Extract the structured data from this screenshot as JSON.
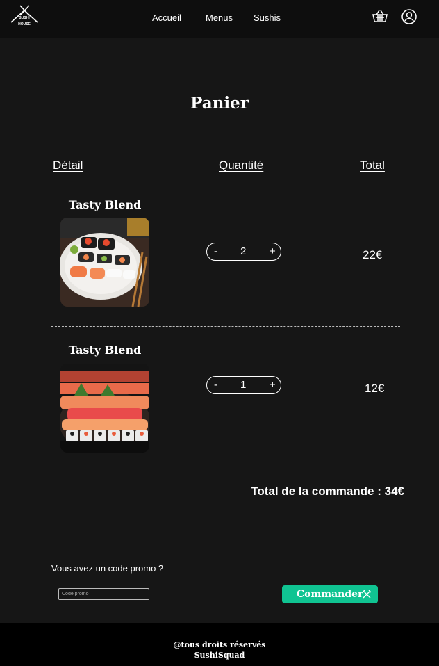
{
  "brand": {
    "logo_line1": "SUSHI",
    "logo_line2": "HOUSE"
  },
  "nav": {
    "items": [
      "Accueil",
      "Menus",
      "Sushis"
    ]
  },
  "icons": {
    "cart": "shopping-basket-icon",
    "user": "user-circle-icon",
    "order": "chopsticks-icon"
  },
  "page": {
    "title": "Panier"
  },
  "table": {
    "headers": {
      "detail": "Détail",
      "quantity": "Quantité",
      "total": "Total"
    }
  },
  "cart": {
    "items": [
      {
        "name": "Tasty Blend",
        "quantity": "2",
        "total": "22€",
        "minus": "-",
        "plus": "+",
        "image": "sushi-plate-photo"
      },
      {
        "name": "Tasty Blend",
        "quantity": "1",
        "total": "12€",
        "minus": "-",
        "plus": "+",
        "image": "sushi-platter-photo"
      }
    ]
  },
  "summary": {
    "total_label": "Total de la commande : 34€"
  },
  "promo": {
    "label": "Vous avez un code promo ?",
    "placeholder": "Code promo",
    "value": ""
  },
  "order_button": {
    "label": "Commander"
  },
  "footer": {
    "line1": "@tous droits réservés",
    "line2": "SushiSquad"
  },
  "colors": {
    "background": "#161616",
    "header": "#0e0e0e",
    "accent": "#10c492",
    "footer": "#000000"
  }
}
